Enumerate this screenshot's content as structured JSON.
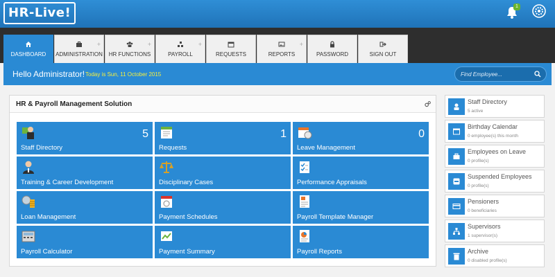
{
  "app": {
    "logo_text": "HR-Live!",
    "notification_count": "1"
  },
  "tabs": [
    {
      "label": "DASHBOARD",
      "icon": "home-icon",
      "active": true,
      "has_plus": false
    },
    {
      "label": "ADMINISTRATION",
      "icon": "briefcase-icon",
      "active": false,
      "has_plus": true
    },
    {
      "label": "HR FUNCTIONS",
      "icon": "users-icon",
      "active": false,
      "has_plus": true
    },
    {
      "label": "PAYROLL",
      "icon": "sitemap-icon",
      "active": false,
      "has_plus": true
    },
    {
      "label": "REQUESTS",
      "icon": "calendar-icon",
      "active": false,
      "has_plus": false
    },
    {
      "label": "REPORTS",
      "icon": "picture-icon",
      "active": false,
      "has_plus": true
    },
    {
      "label": "PASSWORD",
      "icon": "lock-icon",
      "active": false,
      "has_plus": false
    },
    {
      "label": "SIGN OUT",
      "icon": "sign-out-icon",
      "active": false,
      "has_plus": false
    }
  ],
  "header": {
    "greeting": "Hello Administrator!",
    "today": "Today is Sun, 11 October 2015",
    "search_placeholder": "Find Employee..."
  },
  "main": {
    "title": "HR & Payroll Management Solution",
    "tiles": [
      {
        "label": "Staff Directory",
        "count": "5",
        "icon": "staff-icon"
      },
      {
        "label": "Requests",
        "count": "1",
        "icon": "requests-icon"
      },
      {
        "label": "Leave Management",
        "count": "0",
        "icon": "leave-icon"
      },
      {
        "label": "Training & Career Development",
        "count": "",
        "icon": "training-icon"
      },
      {
        "label": "Disciplinary Cases",
        "count": "",
        "icon": "scales-icon"
      },
      {
        "label": "Performance Appraisals",
        "count": "",
        "icon": "checklist-icon"
      },
      {
        "label": "Loan Management",
        "count": "",
        "icon": "coins-icon"
      },
      {
        "label": "Payment Schedules",
        "count": "",
        "icon": "schedule-icon"
      },
      {
        "label": "Payroll Template Manager",
        "count": "",
        "icon": "template-icon"
      },
      {
        "label": "Payroll Calculator",
        "count": "",
        "icon": "calculator-icon"
      },
      {
        "label": "Payment Summary",
        "count": "",
        "icon": "summary-icon"
      },
      {
        "label": "Payroll Reports",
        "count": "",
        "icon": "reports-icon"
      }
    ]
  },
  "sidebar": {
    "items": [
      {
        "title": "Staff Directory",
        "sub": "5 active",
        "icon": "user-icon"
      },
      {
        "title": "Birthday Calendar",
        "sub": "0 employee(s) this month",
        "icon": "calendar-icon"
      },
      {
        "title": "Employees on Leave",
        "sub": "0 profile(s)",
        "icon": "briefcase-icon"
      },
      {
        "title": "Suspended Employees",
        "sub": "0 profile(s)",
        "icon": "minus-icon"
      },
      {
        "title": "Pensioners",
        "sub": "0 beneficiaries",
        "icon": "card-icon"
      },
      {
        "title": "Supervisors",
        "sub": "1 supervisor(s)",
        "icon": "hierarchy-icon"
      },
      {
        "title": "Archive",
        "sub": "0 disabled profile(s)",
        "icon": "trash-icon"
      }
    ]
  },
  "colors": {
    "primary": "#2a8ad4",
    "topbar": "#1f73b8",
    "today_text": "#f7ef3d",
    "badge": "#6ab42d"
  }
}
